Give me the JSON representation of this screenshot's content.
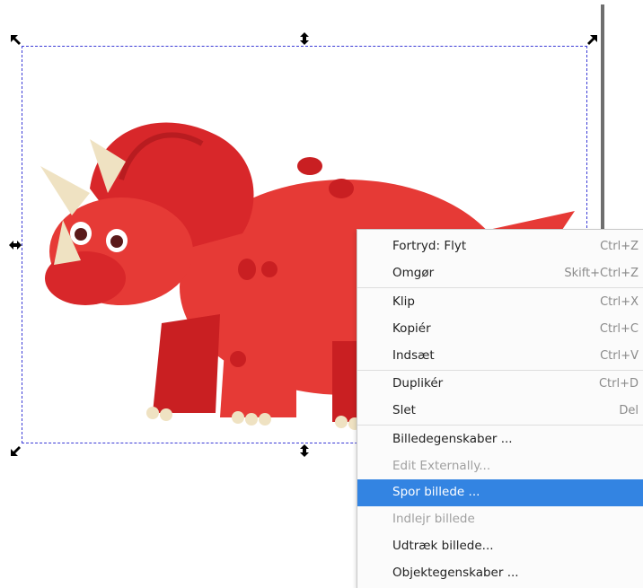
{
  "context_menu": {
    "items": [
      {
        "label": "Fortryd: Flyt",
        "shortcut": "Ctrl+Z",
        "state": "enabled"
      },
      {
        "label": "Omgør",
        "shortcut": "Skift+Ctrl+Z",
        "state": "enabled"
      },
      {
        "label": "Klip",
        "shortcut": "Ctrl+X",
        "state": "enabled"
      },
      {
        "label": "Kopiér",
        "shortcut": "Ctrl+C",
        "state": "enabled"
      },
      {
        "label": "Indsæt",
        "shortcut": "Ctrl+V",
        "state": "enabled"
      },
      {
        "label": "Duplikér",
        "shortcut": "Ctrl+D",
        "state": "enabled"
      },
      {
        "label": "Slet",
        "shortcut": "Del",
        "state": "enabled"
      },
      {
        "label": "Billedegenskaber ...",
        "shortcut": "",
        "state": "enabled"
      },
      {
        "label": "Edit Externally...",
        "shortcut": "",
        "state": "disabled"
      },
      {
        "label": "Spor billede ...",
        "shortcut": "",
        "state": "highlighted"
      },
      {
        "label": "Indlejr billede",
        "shortcut": "",
        "state": "disabled"
      },
      {
        "label": "Udtræk billede...",
        "shortcut": "",
        "state": "enabled"
      },
      {
        "label": "Objektegenskaber ...",
        "shortcut": "",
        "state": "enabled"
      }
    ]
  },
  "colors": {
    "selection_dash": "#3b3bd6",
    "highlight": "#3384e2",
    "dino_body": "#e63a36",
    "dino_dark": "#c91f22",
    "horn": "#efe2c2"
  },
  "canvas": {
    "image_subject": "red triceratops",
    "selection_handles": [
      "corner-rotate",
      "edge-scale"
    ]
  }
}
